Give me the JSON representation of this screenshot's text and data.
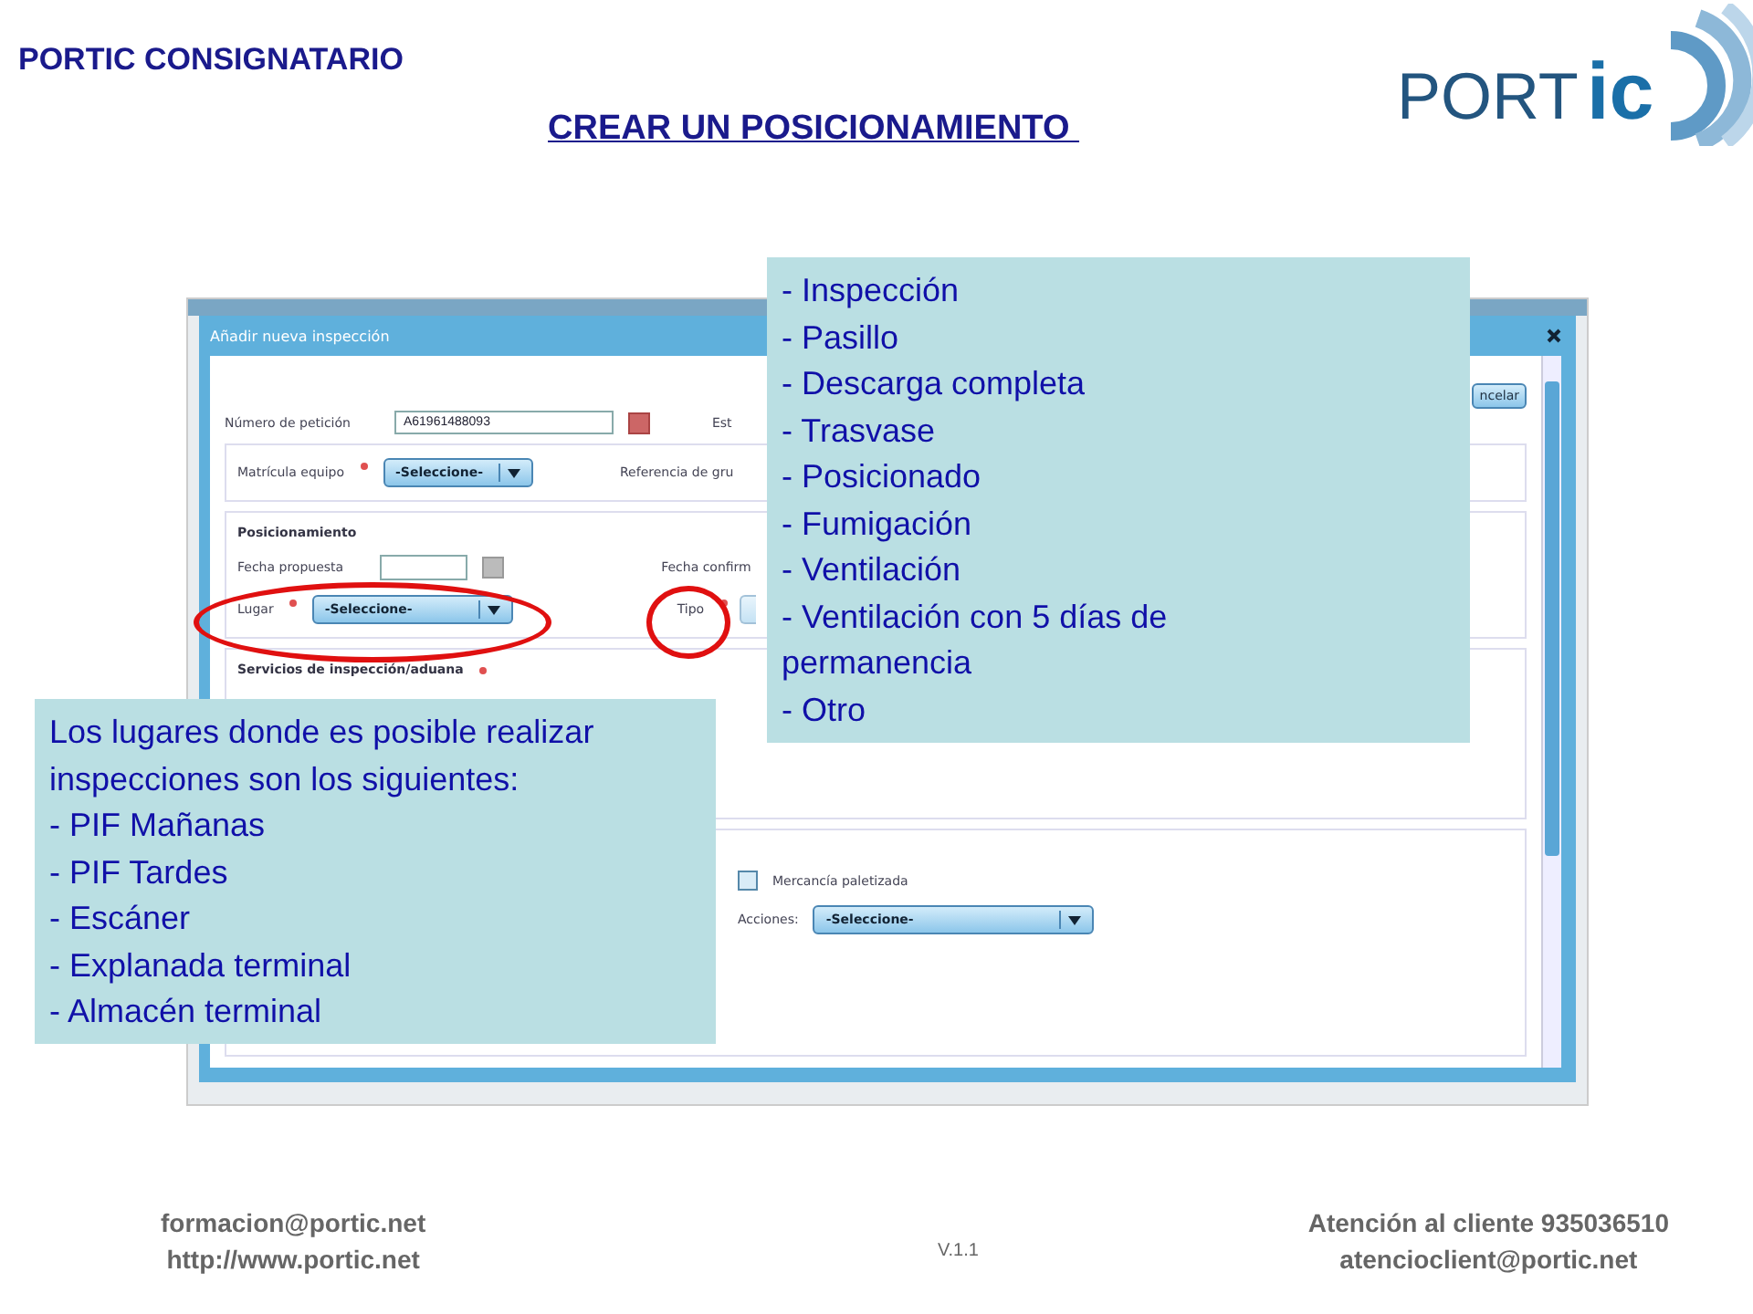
{
  "header": {
    "brand": "PORTIC CONSIGNATARIO",
    "title": "CREAR UN POSICIONAMIENTO",
    "logo": {
      "light": "PORT",
      "bold": "ic"
    }
  },
  "dialog": {
    "title": "Añadir nueva inspección",
    "cancel_button": "ncelar",
    "request": {
      "label": "Número de petición",
      "value": "A61961488093",
      "side_label": "Est"
    },
    "equipment": {
      "label": "Matrícula equipo",
      "required": true,
      "select": "-Seleccione-",
      "side_label": "Referencia de gru"
    },
    "positioning": {
      "heading": "Posicionamiento",
      "date_label": "Fecha propuesta",
      "confirm_label": "Fecha confirm",
      "place": {
        "label": "Lugar",
        "required": true,
        "select": "-Seleccione-",
        "highlighted": true
      },
      "type": {
        "label": "Tipo",
        "required": true,
        "highlighted": true
      }
    },
    "services": {
      "heading": "Servicios de inspección/aduana",
      "required": true
    },
    "cargo": {
      "palletized": {
        "label": "Mercancía paletizada",
        "checked": false
      },
      "actions_label": "Acciones:",
      "actions_select": "-Seleccione-"
    }
  },
  "callouts": [
    {
      "lines": [
        "- Inspección",
        "- Pasillo",
        "- Descarga completa",
        "- Trasvase",
        "- Posicionado",
        "- Fumigación",
        "- Ventilación",
        "- Ventilación con 5 días de permanencia",
        "- Otro"
      ]
    },
    {
      "lines": [
        "Los lugares donde es posible realizar inspecciones son los siguientes:",
        "- PIF Mañanas",
        "- PIF Tardes",
        "- Escáner",
        "- Explanada terminal",
        "- Almacén terminal"
      ]
    }
  ],
  "footer": {
    "left": [
      "formacion@portic.net",
      "http://www.portic.net"
    ],
    "version": "V.1.1",
    "right": [
      "Atención al cliente 935036510",
      "atencioclient@portic.net"
    ]
  }
}
